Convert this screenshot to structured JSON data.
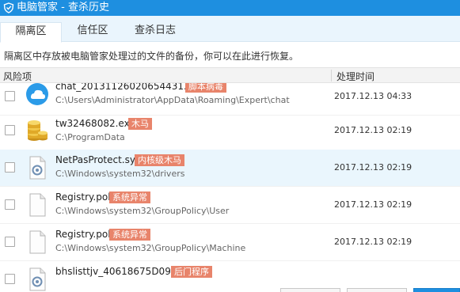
{
  "window": {
    "title": "电脑管家 - 查杀历史"
  },
  "tabs": [
    {
      "label": "隔离区"
    },
    {
      "label": "信任区"
    },
    {
      "label": "查杀日志"
    }
  ],
  "description": "隔离区中存放被电脑管家处理过的文件的备份，你可以在此进行恢复。",
  "columns": {
    "risk": "风险项",
    "time": "处理时间"
  },
  "rows": [
    {
      "name": "chat_20131126020654431.html",
      "badge": "脚本病毒",
      "path": "C:\\Users\\Administrator\\AppData\\Roaming\\Expert\\chat",
      "time": "2017.12.13 04:33",
      "icon": "cloud-app-icon"
    },
    {
      "name": "tw32468082.exe",
      "badge": "木马",
      "path": "C:\\ProgramData",
      "time": "2017.12.13 02:19",
      "icon": "coins-icon"
    },
    {
      "name": "NetPasProtect.sys",
      "badge": "内核级木马",
      "path": "C:\\Windows\\system32\\drivers",
      "time": "2017.12.13 02:19",
      "icon": "system-file-icon"
    },
    {
      "name": "Registry.pol",
      "badge": "系统异常",
      "path": "C:\\Windows\\system32\\GroupPolicy\\User",
      "time": "2017.12.13 02:19",
      "icon": "blank-file-icon"
    },
    {
      "name": "Registry.pol",
      "badge": "系统异常",
      "path": "C:\\Windows\\system32\\GroupPolicy\\Machine",
      "time": "2017.12.13 02:19",
      "icon": "blank-file-icon"
    },
    {
      "name": "bhslisttjv_40618675D099.dll",
      "badge": "后门程序",
      "path": "",
      "time": "",
      "icon": "system-file-icon"
    }
  ],
  "colors": {
    "titlebar": "#1e8fe0",
    "badge": "#e8846b",
    "selected_row": "#eaf6fd"
  }
}
